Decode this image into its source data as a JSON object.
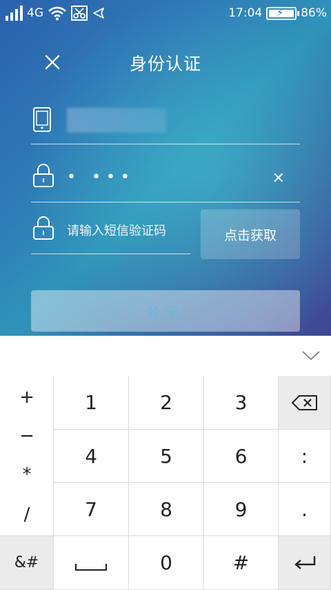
{
  "status_bar": {
    "network": "4G",
    "time": "17:04",
    "battery": "86%"
  },
  "header": {
    "title": "身份认证"
  },
  "form": {
    "password_mask": "• •••",
    "sms_placeholder": "请输入短信验证码",
    "get_code_label": "点击获取",
    "login_label": "登录"
  },
  "keypad": {
    "side_keys": [
      "+",
      "−",
      "*",
      "/"
    ],
    "rows": [
      [
        "1",
        "2",
        "3"
      ],
      [
        "4",
        "5",
        "6"
      ],
      [
        "7",
        "8",
        "9"
      ]
    ],
    "right_keys": [
      ":",
      "."
    ],
    "bottom_left": "&#",
    "bottom_zero": "0",
    "bottom_hash": "#"
  },
  "icons": {
    "close": "close-icon",
    "phone": "phone-icon",
    "lock": "lock-icon",
    "backspace": "backspace-icon",
    "enter": "enter-icon",
    "collapse": "chevron-down-icon"
  }
}
